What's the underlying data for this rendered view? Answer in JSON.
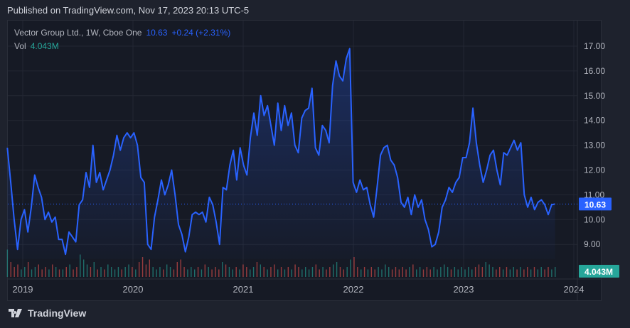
{
  "header": {
    "published": "Published on TradingView.com, Nov 17, 2023 20:13 UTC-5"
  },
  "legend": {
    "symbol": "Vector Group Ltd., 1W, Cboe One",
    "last": "10.63",
    "change": "+0.24 (+2.31%)",
    "vol_label": "Vol",
    "vol_value": "4.043M"
  },
  "footer": {
    "brand": "TradingView"
  },
  "colors": {
    "line": "#2962ff",
    "up": "#26a69a",
    "down": "#ef5350",
    "label_blue": "#2962ff",
    "label_green": "#26a69a"
  },
  "chart_data": {
    "type": "line",
    "title": "Vector Group Ltd., 1W, Cboe One",
    "x_start": 2018.86,
    "x_end": 2023.83,
    "ylim": [
      8.4,
      17.2
    ],
    "y_ticks": [
      "9.00",
      "10.00",
      "11.00",
      "12.00",
      "13.00",
      "14.00",
      "15.00",
      "16.00",
      "17.00"
    ],
    "x_ticks": [
      "2019",
      "2020",
      "2021",
      "2022",
      "2023",
      "2024"
    ],
    "last_price_label": "10.63",
    "volume_label": "4.043M",
    "values": [
      12.9,
      11.5,
      10.0,
      8.8,
      10.0,
      10.4,
      9.5,
      10.5,
      11.8,
      11.3,
      10.9,
      10.0,
      10.3,
      9.9,
      10.1,
      9.2,
      9.2,
      8.6,
      9.5,
      9.3,
      9.1,
      10.6,
      10.8,
      11.9,
      11.3,
      13.0,
      11.5,
      11.9,
      11.2,
      11.6,
      12.0,
      12.6,
      13.4,
      12.8,
      13.3,
      13.5,
      13.3,
      13.5,
      13.0,
      11.7,
      11.5,
      9.0,
      8.8,
      10.1,
      10.8,
      11.6,
      11.0,
      11.4,
      12.0,
      11.0,
      9.8,
      9.4,
      8.7,
      9.3,
      10.2,
      10.3,
      10.2,
      10.3,
      9.9,
      10.9,
      10.6,
      9.9,
      9.0,
      11.3,
      11.2,
      12.2,
      12.8,
      11.6,
      12.9,
      12.2,
      11.8,
      13.3,
      14.3,
      13.4,
      15.0,
      14.2,
      14.6,
      13.8,
      13.0,
      14.7,
      13.6,
      14.6,
      13.8,
      14.3,
      13.0,
      12.7,
      14.1,
      14.4,
      14.5,
      15.3,
      12.9,
      12.6,
      13.8,
      13.6,
      13.1,
      15.4,
      16.4,
      15.8,
      15.6,
      16.5,
      16.9,
      11.5,
      11.1,
      11.6,
      11.2,
      11.3,
      10.6,
      10.1,
      11.3,
      12.6,
      12.9,
      13.0,
      12.4,
      12.2,
      11.7,
      10.7,
      10.5,
      10.9,
      10.2,
      11.0,
      10.5,
      10.8,
      10.0,
      9.6,
      8.9,
      9.0,
      9.5,
      10.5,
      10.8,
      11.3,
      11.1,
      11.5,
      11.7,
      12.5,
      12.5,
      13.1,
      14.5,
      13.1,
      12.2,
      11.5,
      12.0,
      12.6,
      12.8,
      12.0,
      11.4,
      12.7,
      12.6,
      12.9,
      13.2,
      12.8,
      13.1,
      11.0,
      10.5,
      10.9,
      10.4,
      10.7,
      10.8,
      10.6,
      10.2,
      10.6,
      10.63
    ],
    "volume_millions": [
      11,
      6,
      4,
      5,
      3,
      4,
      6,
      3,
      4,
      5,
      3,
      4,
      3,
      5,
      4,
      3,
      3,
      4,
      5,
      3,
      4,
      9,
      7,
      5,
      4,
      6,
      3,
      4,
      3,
      5,
      4,
      3,
      4,
      3,
      4,
      5,
      4,
      3,
      6,
      8,
      5,
      7,
      4,
      3,
      4,
      3,
      5,
      4,
      3,
      6,
      7,
      4,
      3,
      4,
      3,
      4,
      3,
      5,
      4,
      3,
      4,
      3,
      6,
      5,
      4,
      3,
      4,
      3,
      5,
      4,
      3,
      4,
      6,
      5,
      4,
      3,
      4,
      5,
      3,
      4,
      3,
      4,
      3,
      5,
      4,
      3,
      4,
      3,
      4,
      5,
      3,
      4,
      3,
      4,
      5,
      6,
      4,
      3,
      4,
      7,
      8,
      4,
      3,
      4,
      3,
      4,
      3,
      4,
      3,
      5,
      4,
      3,
      4,
      3,
      4,
      3,
      4,
      5,
      3,
      4,
      3,
      4,
      3,
      4,
      3,
      4,
      5,
      4,
      3,
      4,
      3,
      4,
      3,
      4,
      3,
      4,
      5,
      4,
      6,
      5,
      4,
      3,
      4,
      3,
      4,
      3,
      4,
      3,
      4,
      3,
      4,
      3,
      4,
      3,
      4,
      3,
      4,
      3,
      4
    ]
  }
}
